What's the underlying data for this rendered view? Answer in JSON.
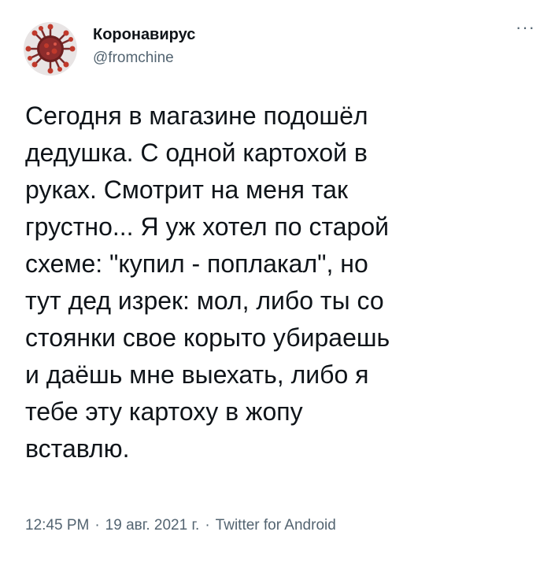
{
  "tweet": {
    "author": {
      "display_name": "Коронавирус",
      "handle": "@fromchine",
      "avatar_icon": "coronavirus-icon"
    },
    "more_label": "···",
    "text_lines": [
      "Сегодня в магазине подошёл",
      "дедушка. С одной картохой в",
      "руках. Смотрит на меня так",
      "грустно... Я уж хотел по старой",
      "схеме: \"купил - поплакал\", но",
      "тут дед изрек: мол, либо ты со",
      "стоянки свое корыто убираешь",
      "и даёшь мне выехать, либо я",
      "тебе эту картоху в жопу",
      "вставлю."
    ],
    "meta": {
      "time": "12:45 PM",
      "separator": "·",
      "date": "19 авг. 2021 г.",
      "source": "Twitter for Android"
    }
  },
  "colors": {
    "text": "#0f1419",
    "secondary": "#536471",
    "avatar_red": "#c0392b",
    "avatar_dark": "#5a1a1a"
  }
}
